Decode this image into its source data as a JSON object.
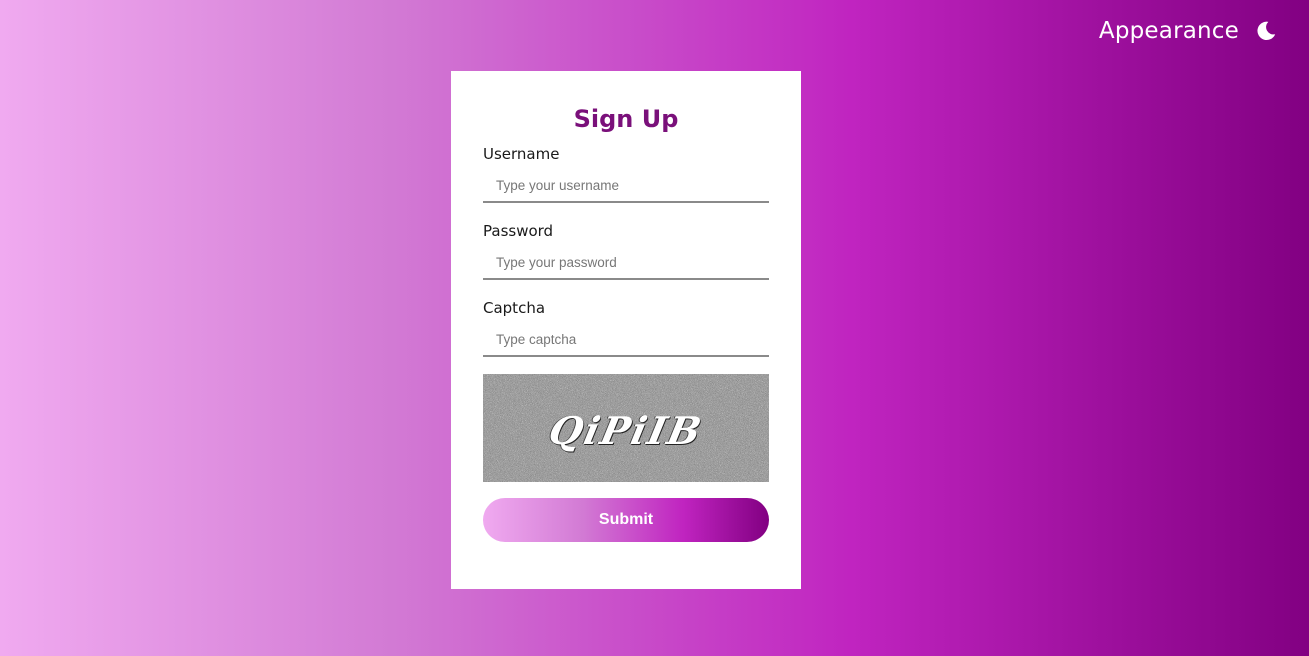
{
  "header": {
    "appearance_label": "Appearance",
    "theme_icon": "moon-icon"
  },
  "form": {
    "title": "Sign Up",
    "username": {
      "label": "Username",
      "placeholder": "Type your username",
      "value": ""
    },
    "password": {
      "label": "Password",
      "placeholder": "Type your password",
      "value": ""
    },
    "captcha": {
      "label": "Captcha",
      "placeholder": "Type captcha",
      "value": ""
    },
    "captcha_image_text": "QiPiIB",
    "submit_label": "Submit"
  },
  "colors": {
    "title": "#7a107a",
    "gradient_start": "#f0aaf0",
    "gradient_mid": "#c024c0",
    "gradient_end": "#820082"
  }
}
